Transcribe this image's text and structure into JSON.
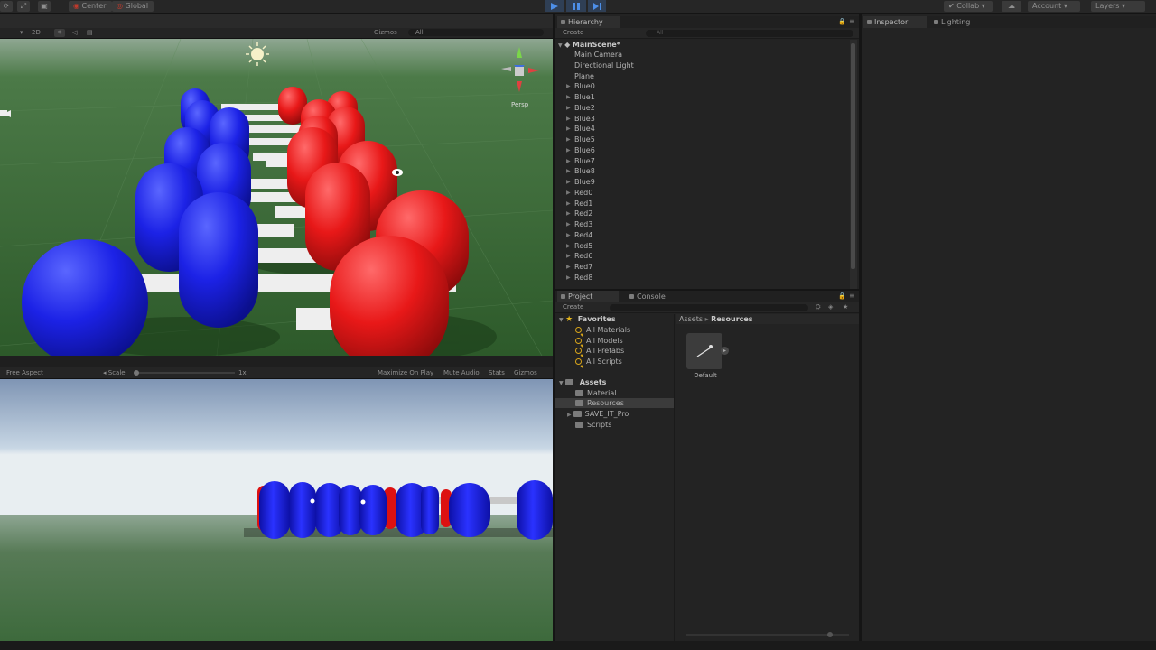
{
  "toolbar": {
    "pivot_label": "Center",
    "space_label": "Global",
    "collab_label": "Collab",
    "account_label": "Account",
    "layers_label": "Layers"
  },
  "scene": {
    "mode_2d": "2D",
    "gizmos_label": "Gizmos",
    "search_placeholder": "All",
    "persp_label": "Persp"
  },
  "game": {
    "aspect_label": "Free Aspect",
    "scale_label": "Scale",
    "scale_value": "1x",
    "maximize_label": "Maximize On Play",
    "mute_label": "Mute Audio",
    "stats_label": "Stats",
    "gizmos_label": "Gizmos"
  },
  "hierarchy": {
    "tab_label": "Hierarchy",
    "create_label": "Create",
    "search_placeholder": "All",
    "scene_name": "MainScene*",
    "items": [
      {
        "label": "Main Camera",
        "expandable": false
      },
      {
        "label": "Directional Light",
        "expandable": false
      },
      {
        "label": "Plane",
        "expandable": false
      },
      {
        "label": "Blue0",
        "expandable": true
      },
      {
        "label": "Blue1",
        "expandable": true
      },
      {
        "label": "Blue2",
        "expandable": true
      },
      {
        "label": "Blue3",
        "expandable": true
      },
      {
        "label": "Blue4",
        "expandable": true
      },
      {
        "label": "Blue5",
        "expandable": true
      },
      {
        "label": "Blue6",
        "expandable": true
      },
      {
        "label": "Blue7",
        "expandable": true
      },
      {
        "label": "Blue8",
        "expandable": true
      },
      {
        "label": "Blue9",
        "expandable": true
      },
      {
        "label": "Red0",
        "expandable": true
      },
      {
        "label": "Red1",
        "expandable": true
      },
      {
        "label": "Red2",
        "expandable": true
      },
      {
        "label": "Red3",
        "expandable": true
      },
      {
        "label": "Red4",
        "expandable": true
      },
      {
        "label": "Red5",
        "expandable": true
      },
      {
        "label": "Red6",
        "expandable": true
      },
      {
        "label": "Red7",
        "expandable": true
      },
      {
        "label": "Red8",
        "expandable": true
      }
    ]
  },
  "inspector": {
    "tab_label": "Inspector",
    "lighting_tab_label": "Lighting"
  },
  "project": {
    "tab_label": "Project",
    "console_tab_label": "Console",
    "create_label": "Create",
    "favorites_label": "Favorites",
    "favorites": [
      "All Materials",
      "All Models",
      "All Prefabs",
      "All Scripts"
    ],
    "assets_label": "Assets",
    "folders": [
      {
        "label": "Material",
        "expandable": false,
        "selected": false
      },
      {
        "label": "Resources",
        "expandable": false,
        "selected": true
      },
      {
        "label": "SAVE_IT_Pro",
        "expandable": true,
        "selected": false
      },
      {
        "label": "Scripts",
        "expandable": false,
        "selected": false
      }
    ],
    "breadcrumb_root": "Assets",
    "breadcrumb_current": "Resources",
    "assets": [
      {
        "label": "Default",
        "icon": "material-ball-icon"
      }
    ]
  },
  "colors": {
    "blue_capsule": "#1a1ee0",
    "red_capsule": "#e01a1a",
    "ground": "#3a6a35",
    "sky": "#b8cde0",
    "panel_bg": "#232323"
  }
}
